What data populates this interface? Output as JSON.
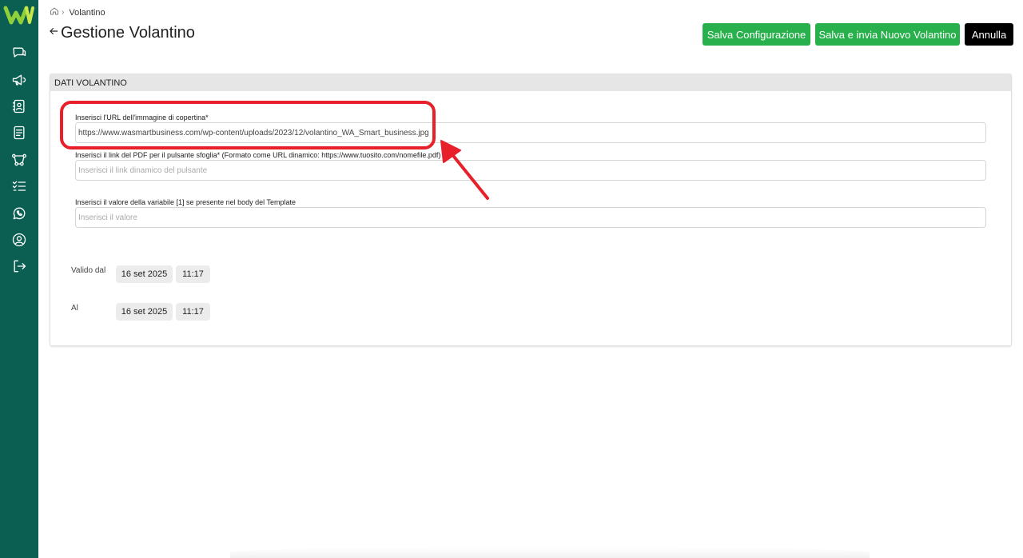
{
  "app": {
    "logo_text": "W",
    "brand_color": "#0b5f52",
    "accent_green": "#28b04c"
  },
  "sidebar": {
    "items": [
      {
        "icon": "chat-icon"
      },
      {
        "icon": "megaphone-icon"
      },
      {
        "icon": "contacts-icon"
      },
      {
        "icon": "document-icon"
      },
      {
        "icon": "flow-icon"
      },
      {
        "icon": "checklist-icon"
      },
      {
        "icon": "whatsapp-icon"
      },
      {
        "icon": "user-icon"
      },
      {
        "icon": "logout-icon"
      }
    ]
  },
  "breadcrumb": {
    "home_icon": "home-icon",
    "current": "Volantino"
  },
  "header": {
    "title": "Gestione Volantino",
    "save_config_label": "Salva Configurazione",
    "save_send_label": "Salva e invia Nuovo Volantino",
    "cancel_label": "Annulla"
  },
  "card": {
    "title": "DATI VOLANTINO",
    "cover_url": {
      "label": "Inserisci l'URL dell'immagine di copertina*",
      "value": "https://www.wasmartbusiness.com/wp-content/uploads/2023/12/volantino_WA_Smart_business.jpg"
    },
    "pdf_link": {
      "label": "Inserisci il link del PDF per il pulsante sfoglia* (Formato come URL dinamico: https://www.tuosito.com/nomefile.pdf)",
      "placeholder": "Inserisci il link dinamico del pulsante"
    },
    "variable": {
      "label": "Inserisci il valore della variabile [1] se presente nel body del Template",
      "placeholder": "Inserisci il valore"
    },
    "valid_from": {
      "label": "Valido dal",
      "date": "16 set 2025",
      "time": "11:17"
    },
    "valid_to": {
      "label": "Al",
      "date": "16 set 2025",
      "time": "11:17"
    }
  },
  "annotation": {
    "color": "#e8202a"
  }
}
